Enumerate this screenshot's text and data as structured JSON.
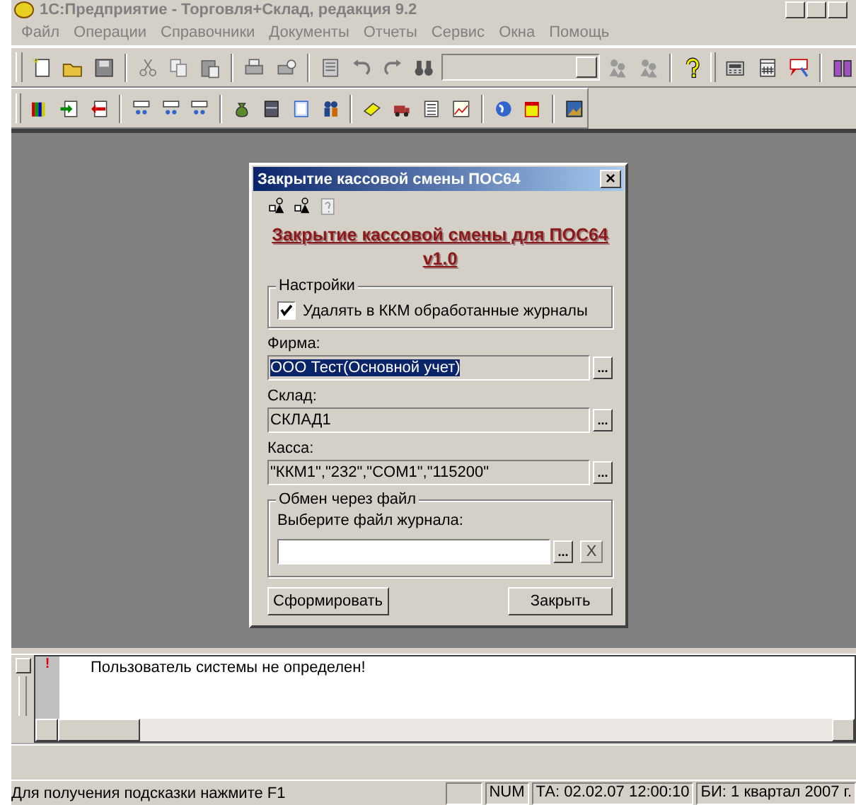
{
  "window": {
    "title": "1С:Предприятие - Торговля+Склад, редакция 9.2"
  },
  "menu": [
    "Файл",
    "Операции",
    "Справочники",
    "Документы",
    "Отчеты",
    "Сервис",
    "Окна",
    "Помощь"
  ],
  "dialog": {
    "title": "Закрытие кассовой смены ПОС64",
    "close": "×",
    "heading": "Закрытие кассовой смены для ПОС64\nv1.0",
    "settings": {
      "legend": "Настройки",
      "checkbox": {
        "label": "Удалять  в ККМ обработанные журналы",
        "checked": true
      }
    },
    "fields": [
      {
        "label": "Фирма:",
        "value": "ООО Тест(Основной учет)",
        "selected": true,
        "button": "..."
      },
      {
        "label": "Склад:",
        "value": "СКЛАД1",
        "selected": false,
        "button": "..."
      },
      {
        "label": "Касса:",
        "value": "\"ККМ1\",\"232\",\"COM1\",\"115200\"",
        "selected": false,
        "button": "..."
      }
    ],
    "file_exchange": {
      "legend": "Обмен через файл",
      "label": "Выберите файл журнала:",
      "button": "...",
      "clear": "X"
    },
    "buttons": [
      "Сформировать",
      "Закрыть"
    ]
  },
  "messages": [
    {
      "kind": "error",
      "mark": "!",
      "text": "Пользователь системы не определен!"
    }
  ],
  "status_bar": {
    "hint": "Для получения подсказки нажмите F1",
    "panels": [
      "NUM",
      "ТА: 02.02.07  12:00:10",
      "БИ: 1 квартал 2007 г."
    ]
  }
}
